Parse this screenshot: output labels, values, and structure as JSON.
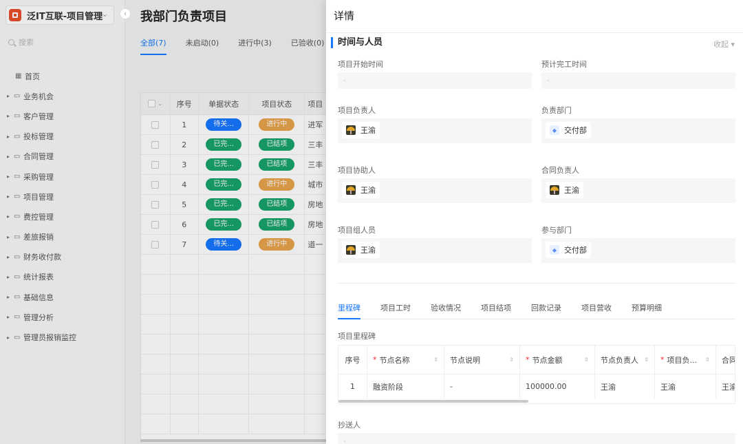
{
  "app": {
    "title": "泛IT互联-项目管理"
  },
  "sidebar": {
    "search_placeholder": "搜索",
    "home": "首页",
    "items": [
      "业务机会",
      "客户管理",
      "投标管理",
      "合同管理",
      "采购管理",
      "项目管理",
      "费控管理",
      "差旅报销",
      "财务收付款",
      "统计报表",
      "基础信息",
      "管理分析",
      "管理员报销监控"
    ]
  },
  "main": {
    "title": "我部门负责项目",
    "tabs": [
      "全部(7)",
      "未启动(0)",
      "进行中(3)",
      "已验收(0)"
    ],
    "columns": [
      "序号",
      "单据状态",
      "项目状态",
      "项目"
    ],
    "rows": [
      {
        "no": "1",
        "doc": "待关...",
        "doc_color": "blue",
        "proj": "进行中",
        "proj_color": "orange",
        "name": "进军"
      },
      {
        "no": "2",
        "doc": "已完...",
        "doc_color": "green",
        "proj": "已结项",
        "proj_color": "green",
        "name": "三丰"
      },
      {
        "no": "3",
        "doc": "已完...",
        "doc_color": "green",
        "proj": "已结项",
        "proj_color": "green",
        "name": "三丰"
      },
      {
        "no": "4",
        "doc": "已完...",
        "doc_color": "green",
        "proj": "进行中",
        "proj_color": "orange",
        "name": "城市"
      },
      {
        "no": "5",
        "doc": "已完...",
        "doc_color": "green",
        "proj": "已结项",
        "proj_color": "green",
        "name": "房地"
      },
      {
        "no": "6",
        "doc": "已完...",
        "doc_color": "green",
        "proj": "已结项",
        "proj_color": "green",
        "name": "房地"
      },
      {
        "no": "7",
        "doc": "待关...",
        "doc_color": "blue",
        "proj": "进行中",
        "proj_color": "orange",
        "name": "道一"
      }
    ]
  },
  "drawer": {
    "title": "详情",
    "section_title": "时间与人员",
    "collapse": "收起",
    "fields": {
      "start_time": {
        "label": "项目开始时间",
        "value": "-"
      },
      "end_time": {
        "label": "预计完工时间",
        "value": "-"
      },
      "leader": {
        "label": "项目负责人",
        "value": "王渝"
      },
      "dept": {
        "label": "负责部门",
        "value": "交付部"
      },
      "assistant": {
        "label": "项目协助人",
        "value": "王渝"
      },
      "contract_leader": {
        "label": "合同负责人",
        "value": "王渝"
      },
      "members": {
        "label": "项目组人员",
        "value": "王渝"
      },
      "join_dept": {
        "label": "参与部门",
        "value": "交付部"
      }
    },
    "tabs": [
      "里程碑",
      "项目工时",
      "验收情况",
      "项目结项",
      "回款记录",
      "项目营收",
      "预算明细"
    ],
    "milestone_title": "项目里程碑",
    "milestone_columns": [
      "序号",
      "节点名称",
      "节点说明",
      "节点金额",
      "节点负责人",
      "项目负...",
      "合同"
    ],
    "milestone_row": [
      "1",
      "融资阶段",
      "-",
      "100000.00",
      "王渝",
      "王渝",
      "王渝"
    ],
    "cc": {
      "label": "抄送人",
      "value": "-"
    }
  }
}
